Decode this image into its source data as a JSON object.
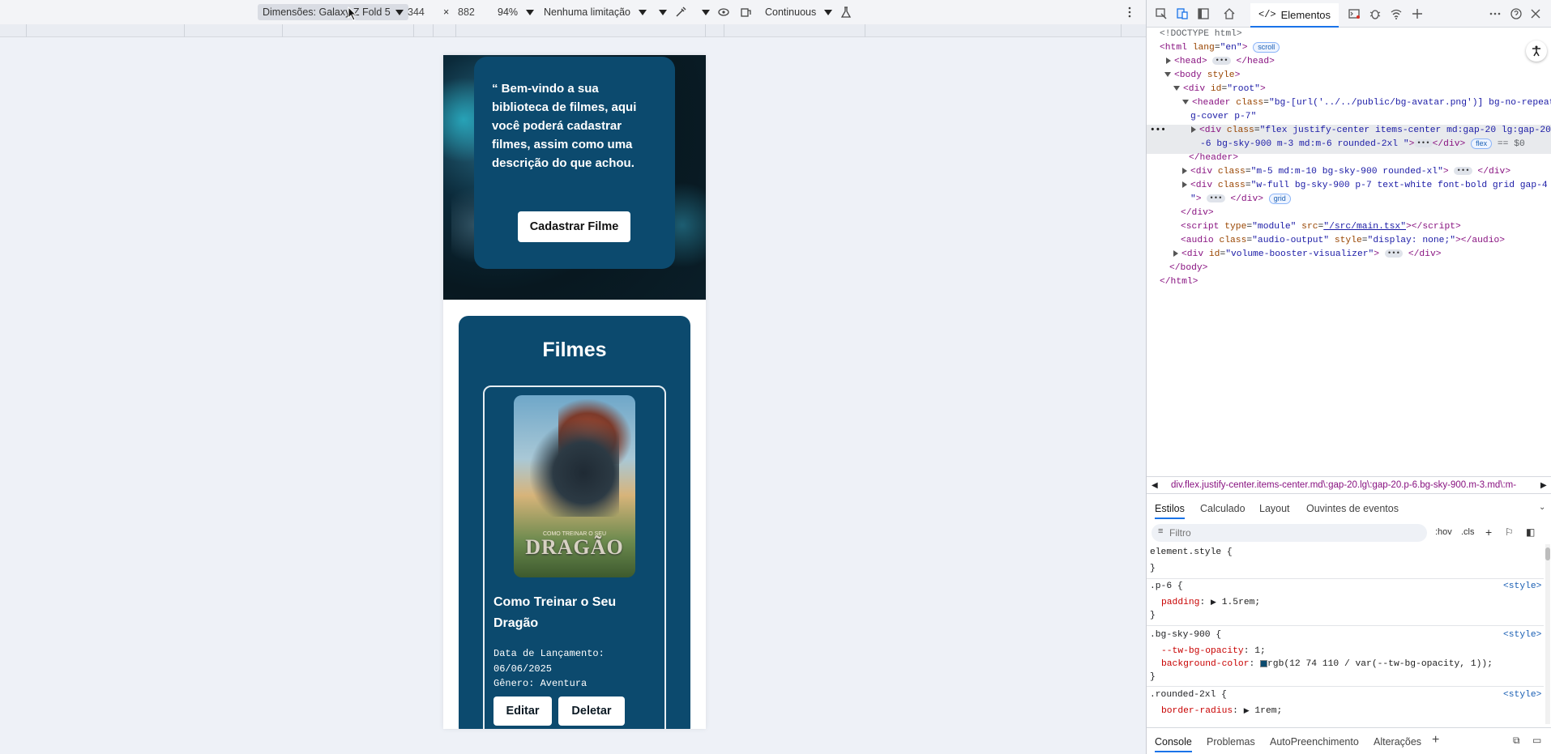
{
  "device_toolbar": {
    "dimensions_label": "Dimensões: Galaxy Z Fold 5",
    "width": "344",
    "times": "×",
    "height": "882",
    "zoom": "94%",
    "throttling": "Nenhuma limitação",
    "mode": "Continuous"
  },
  "app": {
    "hero_text": "“ Bem-vindo a sua biblioteca de filmes, aqui você poderá cadastrar filmes, assim como uma descrição do que achou.",
    "register_button": "Cadastrar Filme",
    "section_title": "Filmes",
    "film": {
      "poster_word": "DRAGÃO",
      "poster_sub": "COMO TREINAR O SEU",
      "title": "Como Treinar o Seu Dragão",
      "release_label": "Data de Lançamento:",
      "release_date": "06/06/2025",
      "genre_line": "Gênero: Aventura",
      "edit_button": "Editar",
      "delete_button": "Deletar"
    }
  },
  "devtools": {
    "elements_tab": "Elementos",
    "dom": {
      "doctype": "<!DOCTYPE html>",
      "html_open": "html",
      "html_lang_attr": "lang",
      "html_lang_val": "\"en\"",
      "scroll_badge": "scroll",
      "head": "head",
      "body": "body",
      "body_attr": "style",
      "root_div_attr": "id",
      "root_div_val": "\"root\"",
      "header_attr": "class",
      "header_val_1": "\"bg-[url('../../public/bg-avatar.png')] bg-no-repeat b",
      "header_val_2": "g-cover p-7\"",
      "sel_val_1": "\"flex justify-center items-center md:gap-20 lg:gap-20 p",
      "sel_val_2": "-6 bg-sky-900 m-3 md:m-6 rounded-2xl \"",
      "flex_badge": "flex",
      "eq_s0": "== $0",
      "header_close": "</header>",
      "div2_val": "\"m-5 md:m-10 bg-sky-900 rounded-xl\"",
      "div3_val_1": "\"w-full bg-sky-900 p-7 text-white font-bold grid gap-4",
      "div3_val_2": "\"",
      "grid_badge": "grid",
      "div_close": "</div>",
      "script_type": "\"module\"",
      "script_src": "\"/src/main.tsx\"",
      "audio_class": "\"audio-output\"",
      "audio_style": "\"display: none;\"",
      "vb_id": "\"volume-booster-visualizer\"",
      "body_close": "</body>",
      "html_close": "</html>"
    },
    "breadcrumb": "div.flex.justify-center.items-center.md\\:gap-20.lg\\:gap-20.p-6.bg-sky-900.m-3.md\\:m-",
    "styles_tabs": [
      "Estilos",
      "Calculado",
      "Layout",
      "Ouvintes de eventos"
    ],
    "filter_placeholder": "Filtro",
    "hov": ":hov",
    "cls": ".cls",
    "styles": {
      "element_style": "element.style {",
      "close": "}",
      "p6_selector": ".p-6 {",
      "p6_prop": "padding",
      "p6_val": "1.5rem;",
      "bg_selector": ".bg-sky-900 {",
      "bg_prop1": "--tw-bg-opacity",
      "bg_val1": "1;",
      "bg_prop2": "background-color",
      "bg_val2": "rgb(12 74 110 / var(--tw-bg-opacity, 1));",
      "r_selector": ".rounded-2xl {",
      "r_prop": "border-radius",
      "r_val": "1rem;",
      "source": "<style>"
    },
    "drawer_tabs": [
      "Console",
      "Problemas",
      "AutoPreenchimento",
      "Alterações"
    ]
  },
  "colors": {
    "sky900": "#0c4a6e",
    "accent": "#1a73e8"
  }
}
